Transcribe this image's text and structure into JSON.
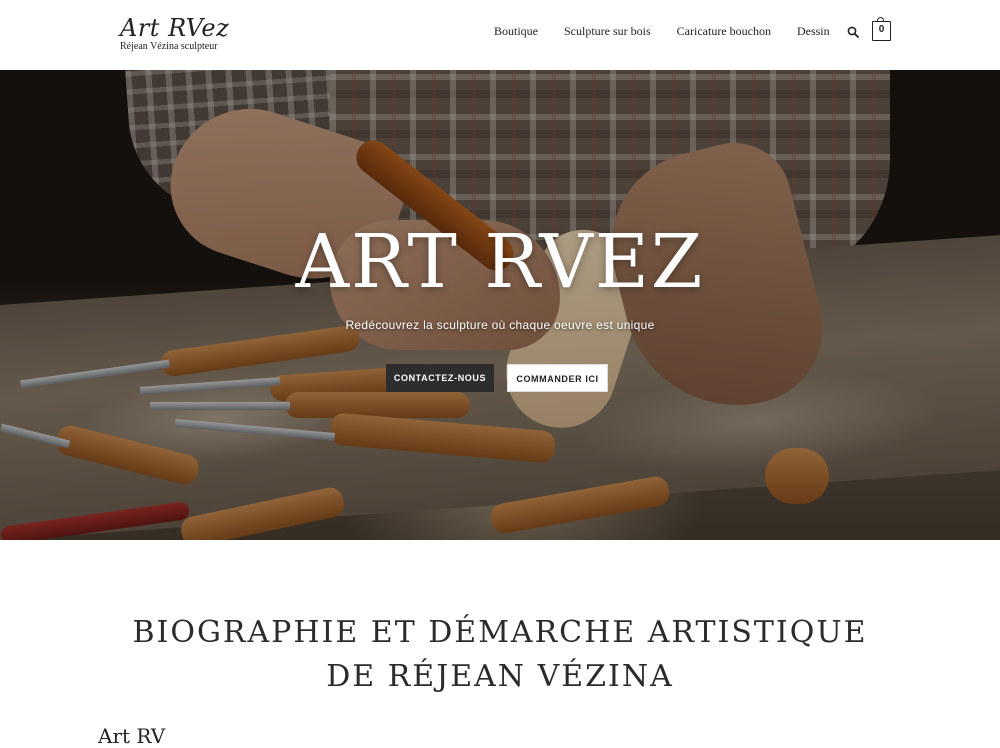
{
  "logo": {
    "main": "Art RVez",
    "sub": "Réjean Vézina sculpteur"
  },
  "nav": {
    "items": [
      "Boutique",
      "Sculpture sur bois",
      "Caricature bouchon",
      "Dessin"
    ],
    "search_icon": "search-icon",
    "cart_icon": "shopping-bag-icon",
    "cart_count": "0"
  },
  "hero": {
    "title": "ART RVEZ",
    "subtitle": "Redécouvrez la sculpture où chaque oeuvre est unique",
    "buttons": {
      "contact": "CONTACTEZ-NOUS",
      "order": "COMMANDER ICI"
    }
  },
  "bio": {
    "title_line1": "BIOGRAPHIE ET DÉMARCHE ARTISTIQUE",
    "title_line2": "DE RÉJEAN VÉZINA",
    "next_text": "Art RV"
  },
  "colors": {
    "text": "#222222",
    "dark_button": "#2d2d2d"
  }
}
